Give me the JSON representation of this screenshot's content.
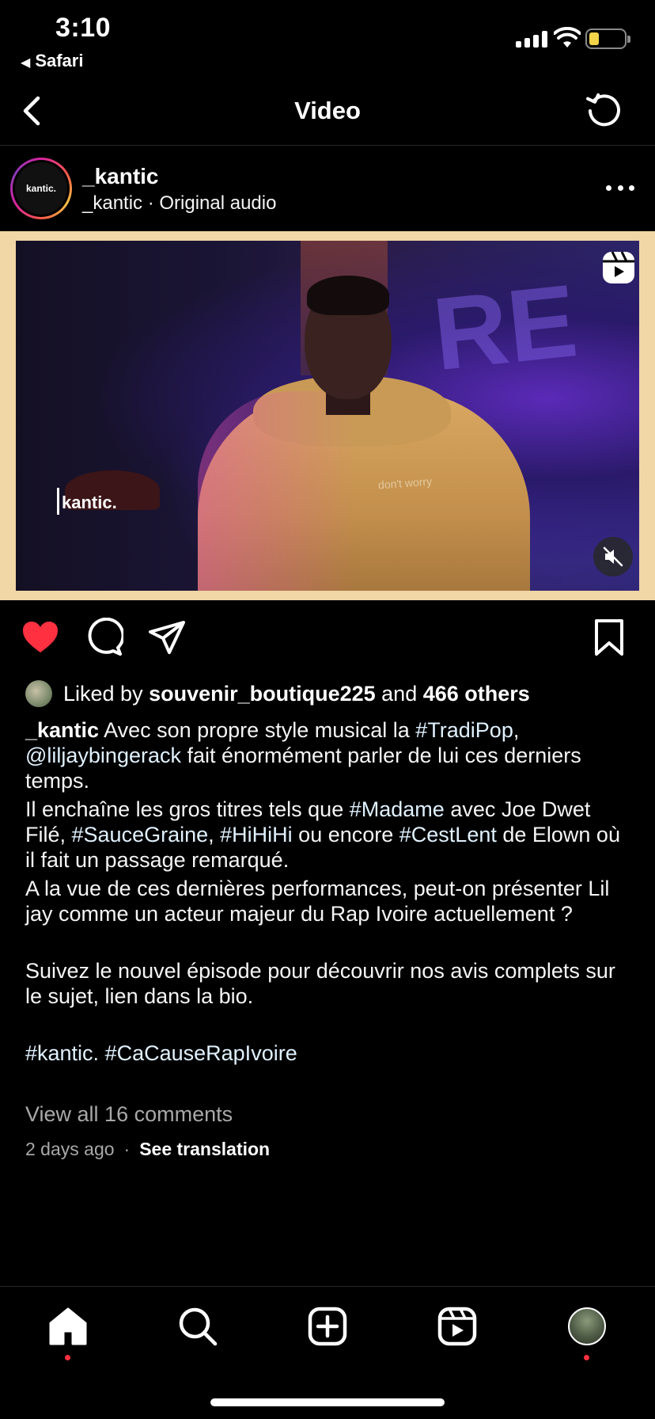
{
  "status_bar": {
    "time": "3:10",
    "back_app": "Safari",
    "battery_color": "#f2d34a"
  },
  "nav": {
    "title": "Video",
    "back_icon": "chevron-left-icon",
    "refresh_icon": "refresh-icon"
  },
  "post": {
    "avatar_text": "kantic.",
    "username": "_kantic",
    "subline": "_kantic · Original audio"
  },
  "video": {
    "watermark": "kantic.",
    "hoodie_text": "don't worry",
    "graffiti_text": "RE",
    "muted": true
  },
  "actions": {
    "liked": true,
    "like_color": "#ff3040"
  },
  "likes": {
    "prefix": "Liked by ",
    "user": "souvenir_boutique225",
    "middle": " and ",
    "others": "466 others"
  },
  "caption": {
    "user": "_kantic",
    "p1_a": " Avec son propre style musical la ",
    "tag_tradipop": "#TradiPop",
    "p1_b": ",",
    "mention": "@liljaybingerack",
    "p1_c": " fait énormément parler de lui ces derniers temps.",
    "p2_a": "Il enchaîne les gros titres tels que ",
    "tag_madame": "#Madame",
    "p2_b": " avec Joe Dwet Filé, ",
    "tag_sauce": "#SauceGraine",
    "p2_c": ", ",
    "tag_hihihi": "#HiHiHi",
    "p2_d": " ou encore ",
    "tag_cestlent": "#CestLent",
    "p2_e": " de Elown où il fait un passage remarqué.",
    "p3": "A la vue de ces dernières performances, peut-on présenter Lil jay comme un acteur majeur du Rap Ivoire actuellement ?",
    "p4": "Suivez le nouvel épisode pour découvrir nos avis complets sur le sujet, lien dans la bio.",
    "tag_kantic": "#kantic.",
    "tag_cacause": "#CaCauseRapIvoire"
  },
  "comments": {
    "view_all": "View all 16 comments"
  },
  "meta": {
    "time_ago": "2 days ago",
    "separator": "·",
    "see_translation": "See translation"
  },
  "tabbar": {
    "items": [
      "home-icon",
      "search-icon",
      "create-icon",
      "reels-icon",
      "profile-avatar"
    ],
    "notification_dot_color": "#ff3040"
  }
}
